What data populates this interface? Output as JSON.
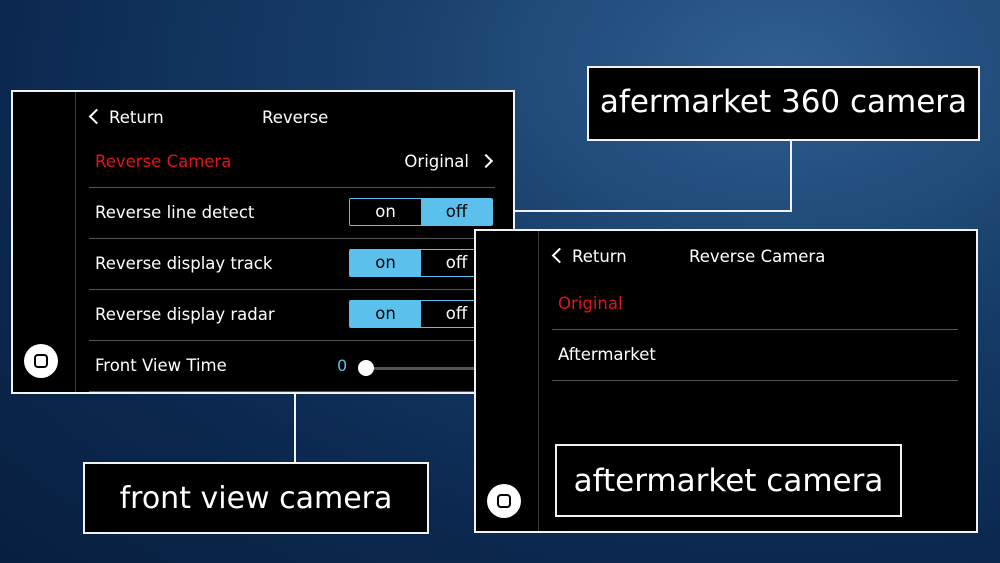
{
  "screen_reverse": {
    "header": {
      "return_label": "Return",
      "title": "Reverse"
    },
    "rows": [
      {
        "label": "Reverse Camera",
        "value": "Original"
      },
      {
        "label": "Reverse line detect",
        "on": "on",
        "off": "off",
        "selected": "off"
      },
      {
        "label": "Reverse display track",
        "on": "on",
        "off": "off",
        "selected": "on"
      },
      {
        "label": "Reverse display radar",
        "on": "on",
        "off": "off",
        "selected": "on"
      },
      {
        "label": "Front View Time",
        "value": "0"
      }
    ]
  },
  "screen_camera": {
    "header": {
      "return_label": "Return",
      "title": "Reverse Camera"
    },
    "options": [
      {
        "label": "Original",
        "selected": true
      },
      {
        "label": "Aftermarket",
        "selected": false
      }
    ]
  },
  "callouts": {
    "aftermarket_360": "afermarket 360 camera",
    "front_view": "front view camera",
    "aftermarket": "aftermarket camera"
  },
  "colors": {
    "accent": "#5bc0eb",
    "selected_text": "#e0151b",
    "background": "#0b2850"
  },
  "icons": {
    "home": "home-button-icon",
    "back": "chevron-left-icon",
    "forward": "chevron-right-icon"
  }
}
